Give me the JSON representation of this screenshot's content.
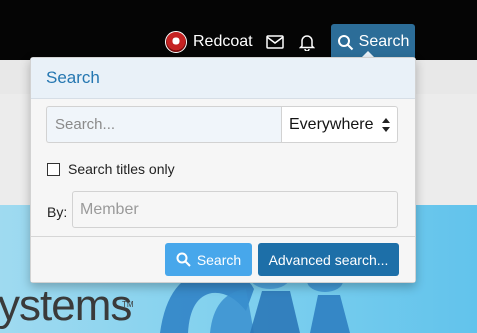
{
  "topbar": {
    "username": "Redcoat",
    "icons": [
      "inbox-icon",
      "bell-icon"
    ],
    "search_tab_label": "Search"
  },
  "banner": {
    "text": "ystems",
    "tm": "TM"
  },
  "search_menu": {
    "title": "Search",
    "keywords_placeholder": "Search...",
    "scope_selected": "Everywhere",
    "titles_only_label": "Search titles only",
    "titles_only_checked": false,
    "by_label": "By:",
    "member_placeholder": "Member",
    "search_button_label": "Search",
    "advanced_button_label": "Advanced search..."
  },
  "colors": {
    "header_text": "#2577b1",
    "primary_button": "#47a7eb",
    "secondary_button": "#1d6fa8",
    "search_tab": "#2c6d98"
  }
}
